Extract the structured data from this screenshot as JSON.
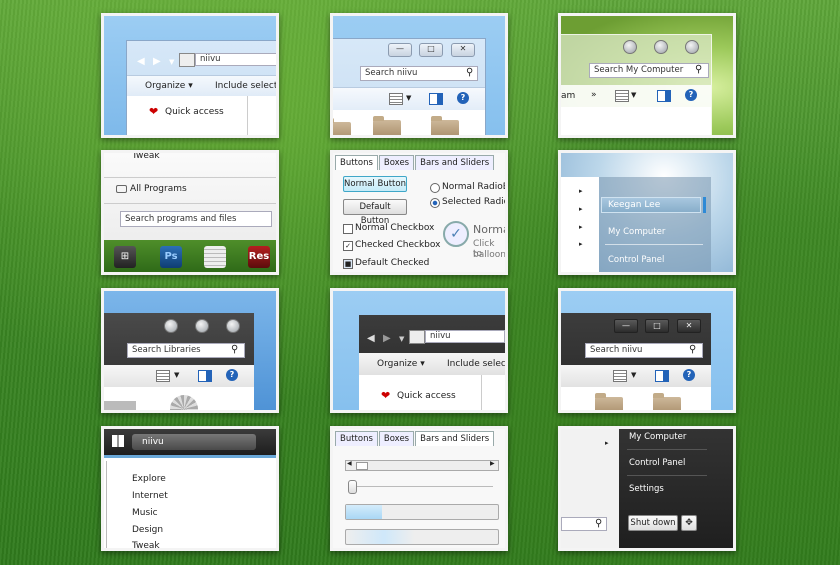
{
  "tile1": {
    "quick_access": "Quick access",
    "organize": "Organize",
    "include": "Include selecte",
    "address": "niivu"
  },
  "tile2": {
    "search_placeholder": "Search niivu"
  },
  "tile3": {
    "search_placeholder": "Search My Computer"
  },
  "tile4": {
    "tweak": "Tweak",
    "all_programs": "All Programs",
    "search_placeholder": "Search programs and files",
    "taskbar": [
      "Ps",
      "Res"
    ]
  },
  "tile5": {
    "tabs": [
      "Buttons",
      "Boxes",
      "Bars and Sliders"
    ],
    "normal_button": "Normal Button",
    "default_button": "Default Button",
    "normal_checkbox": "Normal Checkbox",
    "checked_checkbox": "Checked Checkbox",
    "default_checked": "Default Checked",
    "normal_radio": "Normal RadioButt",
    "selected_radio": "Selected RadioBu",
    "balloon_title": "Norma",
    "balloon_line1": "Click to",
    "balloon_line2": "balloon"
  },
  "tile6": {
    "user": "Keegan Lee",
    "my_computer": "My Computer",
    "control_panel": "Control Panel"
  },
  "tile7": {
    "search_placeholder": "Search Libraries"
  },
  "tile8": {
    "address": "niivu",
    "organize": "Organize",
    "include": "Include select",
    "quick_access": "Quick access"
  },
  "tile9": {
    "search_placeholder": "Search niivu"
  },
  "tile10": {
    "address": "niivu",
    "items": [
      "Explore",
      "Internet",
      "Music",
      "Design",
      "Tweak"
    ]
  },
  "tile11": {
    "tabs": [
      "Buttons",
      "Boxes",
      "Bars and Sliders"
    ]
  },
  "tile12": {
    "my_computer": "My Computer",
    "control_panel": "Control Panel",
    "settings": "Settings",
    "shutdown": "Shut down"
  },
  "colors": {
    "sky": "#8ec3f0",
    "help_blue": "#2363b8",
    "dark_panel": "#2e2e2e"
  }
}
